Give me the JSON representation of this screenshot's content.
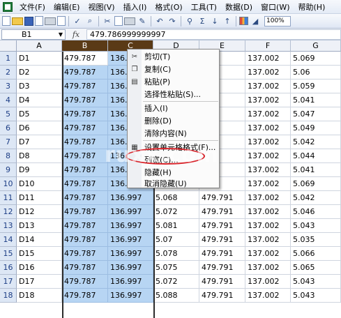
{
  "menubar": {
    "items": [
      "文件(F)",
      "编辑(E)",
      "视图(V)",
      "插入(I)",
      "格式(O)",
      "工具(T)",
      "数据(D)",
      "窗口(W)",
      "帮助(H)"
    ]
  },
  "toolbar": {
    "zoom": "100%"
  },
  "formula_bar": {
    "name_box": "B1",
    "fx": "fx",
    "content": "479.786999999997"
  },
  "sheet": {
    "columns": [
      "A",
      "B",
      "C",
      "D",
      "E",
      "F",
      "G"
    ],
    "selected_columns": [
      "B",
      "C"
    ],
    "rows": [
      {
        "num": "1",
        "A": "D1",
        "B": "479.787",
        "C": "136.",
        "D": "",
        "E": "791",
        "F": "137.002",
        "G": "5.069"
      },
      {
        "num": "2",
        "A": "D2",
        "B": "479.787",
        "C": "136.",
        "D": "",
        "E": "791",
        "F": "137.002",
        "G": "5.06"
      },
      {
        "num": "3",
        "A": "D3",
        "B": "479.787",
        "C": "136.",
        "D": "",
        "E": "791",
        "F": "137.002",
        "G": "5.059"
      },
      {
        "num": "4",
        "A": "D4",
        "B": "479.787",
        "C": "136.",
        "D": "",
        "E": "791",
        "F": "137.002",
        "G": "5.041"
      },
      {
        "num": "5",
        "A": "D5",
        "B": "479.787",
        "C": "136.",
        "D": "",
        "E": "791",
        "F": "137.002",
        "G": "5.047"
      },
      {
        "num": "6",
        "A": "D6",
        "B": "479.787",
        "C": "136.",
        "D": "",
        "E": "791",
        "F": "137.002",
        "G": "5.049"
      },
      {
        "num": "7",
        "A": "D7",
        "B": "479.787",
        "C": "136.",
        "D": "",
        "E": "791",
        "F": "137.002",
        "G": "5.042"
      },
      {
        "num": "8",
        "A": "D8",
        "B": "479.787",
        "C": "136.",
        "D": "",
        "E": "791",
        "F": "137.002",
        "G": "5.044"
      },
      {
        "num": "9",
        "A": "D9",
        "B": "479.787",
        "C": "136.",
        "D": "",
        "E": "791",
        "F": "137.002",
        "G": "5.041"
      },
      {
        "num": "10",
        "A": "D10",
        "B": "479.787",
        "C": "136.",
        "D": "",
        "E": "791",
        "F": "137.002",
        "G": "5.069"
      },
      {
        "num": "11",
        "A": "D11",
        "B": "479.787",
        "C": "136.997",
        "D": "5.068",
        "E": "479.791",
        "F": "137.002",
        "G": "5.042"
      },
      {
        "num": "12",
        "A": "D12",
        "B": "479.787",
        "C": "136.997",
        "D": "5.072",
        "E": "479.791",
        "F": "137.002",
        "G": "5.046"
      },
      {
        "num": "13",
        "A": "D13",
        "B": "479.787",
        "C": "136.997",
        "D": "5.081",
        "E": "479.791",
        "F": "137.002",
        "G": "5.043"
      },
      {
        "num": "14",
        "A": "D14",
        "B": "479.787",
        "C": "136.997",
        "D": "5.07",
        "E": "479.791",
        "F": "137.002",
        "G": "5.035"
      },
      {
        "num": "15",
        "A": "D15",
        "B": "479.787",
        "C": "136.997",
        "D": "5.078",
        "E": "479.791",
        "F": "137.002",
        "G": "5.066"
      },
      {
        "num": "16",
        "A": "D16",
        "B": "479.787",
        "C": "136.997",
        "D": "5.075",
        "E": "479.791",
        "F": "137.002",
        "G": "5.065"
      },
      {
        "num": "17",
        "A": "D17",
        "B": "479.787",
        "C": "136.997",
        "D": "5.072",
        "E": "479.791",
        "F": "137.002",
        "G": "5.043"
      },
      {
        "num": "18",
        "A": "D18",
        "B": "479.787",
        "C": "136.997",
        "D": "5.088",
        "E": "479.791",
        "F": "137.002",
        "G": "5.043"
      }
    ]
  },
  "context_menu": {
    "items": [
      {
        "label": "剪切(T)",
        "icon": "scissors-icon"
      },
      {
        "label": "复制(C)",
        "icon": "copy-icon"
      },
      {
        "label": "粘贴(P)",
        "icon": "paste-icon"
      },
      {
        "label": "选择性粘贴(S)...",
        "icon": ""
      },
      {
        "label": "插入(I)",
        "icon": ""
      },
      {
        "label": "删除(D)",
        "icon": ""
      },
      {
        "label": "清除内容(N)",
        "icon": ""
      },
      {
        "label": "设置单元格格式(F)...",
        "icon": "format-cells-icon"
      },
      {
        "label": "列宽(C)...",
        "icon": ""
      },
      {
        "label": "隐藏(H)",
        "icon": ""
      },
      {
        "label": "取消隐藏(U)",
        "icon": ""
      }
    ],
    "highlighted_item": "列宽(C)..."
  },
  "watermark": {
    "text": "ruxx.com"
  },
  "colors": {
    "selected_header": "#5a3a16",
    "selected_cells": "#b7d5f3",
    "highlight_ring": "#d8232a",
    "row_header": "#dde7f5"
  }
}
